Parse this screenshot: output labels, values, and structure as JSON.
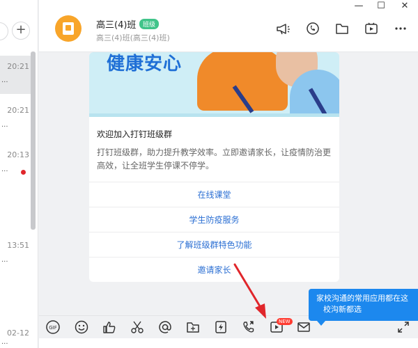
{
  "left_panel": {
    "add_label": "+",
    "conversations": [
      {
        "time": "20:21",
        "fragment": "..."
      },
      {
        "time": "20:21",
        "fragment": "..."
      },
      {
        "time": "20:13",
        "fragment": "..."
      },
      {
        "time": "13:51",
        "fragment": "..."
      },
      {
        "time": "02-12",
        "fragment": "..."
      }
    ]
  },
  "header": {
    "title": "高三(4)班",
    "badge": "班级",
    "subtitle": "高三(4)班(高三(4)班)",
    "window_controls": {
      "minimize": "—",
      "maximize": "☐",
      "close": "✕"
    }
  },
  "card": {
    "banner_text": "健康安心",
    "title": "欢迎加入打钉班级群",
    "description": "打钉班级群，助力提升教学效率。立即邀请家长，让疫情防治更高效，让全班学生停课不停学。",
    "links": [
      "在线课堂",
      "学生防疫服务",
      "了解班级群特色功能",
      "邀请家长"
    ]
  },
  "toolbar": {
    "gif_label": "GIF",
    "new_badge": "NEW"
  },
  "tooltip": {
    "line1": "家校沟通的常用应用都在这",
    "line2": "校沟新都选"
  },
  "colors": {
    "accent": "#2b6fd3",
    "tooltip": "#1c88ee",
    "avatar": "#f8a52a",
    "badge": "#41c48a",
    "annotation": "#e0262b"
  }
}
